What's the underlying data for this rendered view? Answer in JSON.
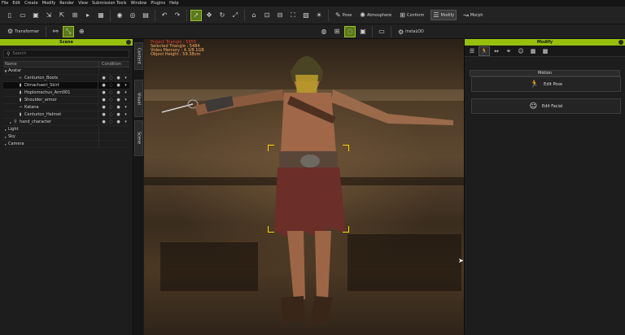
{
  "menu": [
    "File",
    "Edit",
    "Create",
    "Modify",
    "Render",
    "View",
    "Submission Tools",
    "Window",
    "Plugins",
    "Help"
  ],
  "toolbar": {
    "pose": "Pose",
    "atmosphere": "Atmosphere",
    "conform": "Conform",
    "modify": "Modify",
    "morph": "Morph"
  },
  "toolbar2": {
    "transformer": "Transformer",
    "instalod": "InstaLOD"
  },
  "scene": {
    "title": "Scene",
    "search_placeholder": "Search",
    "col_name": "Name",
    "col_condition": "Condition",
    "rows": [
      {
        "label": "Avatar",
        "level": 0,
        "expand": "▼",
        "icon": ""
      },
      {
        "label": "Centurion_Boots",
        "level": 2,
        "expand": "",
        "icon": "≈"
      },
      {
        "label": "Dimachaeri_Skirt",
        "level": 2,
        "expand": "",
        "icon": "▮",
        "selected": true
      },
      {
        "label": "Hoplomachus_Arm001",
        "level": 2,
        "expand": "",
        "icon": "▮"
      },
      {
        "label": "Shoulder_armor",
        "level": 2,
        "expand": "",
        "icon": "▮"
      },
      {
        "label": "Katana",
        "level": 2,
        "expand": "",
        "icon": "⊸"
      },
      {
        "label": "Centurion_Helmet",
        "level": 2,
        "expand": "",
        "icon": "▮"
      },
      {
        "label": "hand_character",
        "level": 1,
        "expand": "▸",
        "icon": "⚲"
      },
      {
        "label": "Light",
        "level": 0,
        "expand": "▸",
        "icon": ""
      },
      {
        "label": "Sky",
        "level": 0,
        "expand": "▸",
        "icon": ""
      },
      {
        "label": "Camera",
        "level": 0,
        "expand": "▸",
        "icon": ""
      }
    ]
  },
  "vtabs": [
    "Content",
    "Visual",
    "Scene"
  ],
  "viewport_stats": {
    "line1": "Project Triangle : 5955",
    "line2": "Selected Triangle : 5484",
    "line3": "Video Memory : 4.3/8.1GB",
    "line4": "Object Height : 59.38cm"
  },
  "modify_panel": {
    "title": "Modify",
    "section": "Motion",
    "edit_pose": "Edit Pose",
    "edit_facial": "Edit Facial"
  },
  "colors": {
    "accent": "#97bf0d",
    "stats": "#ffb060",
    "bracket": "#ffd400"
  }
}
